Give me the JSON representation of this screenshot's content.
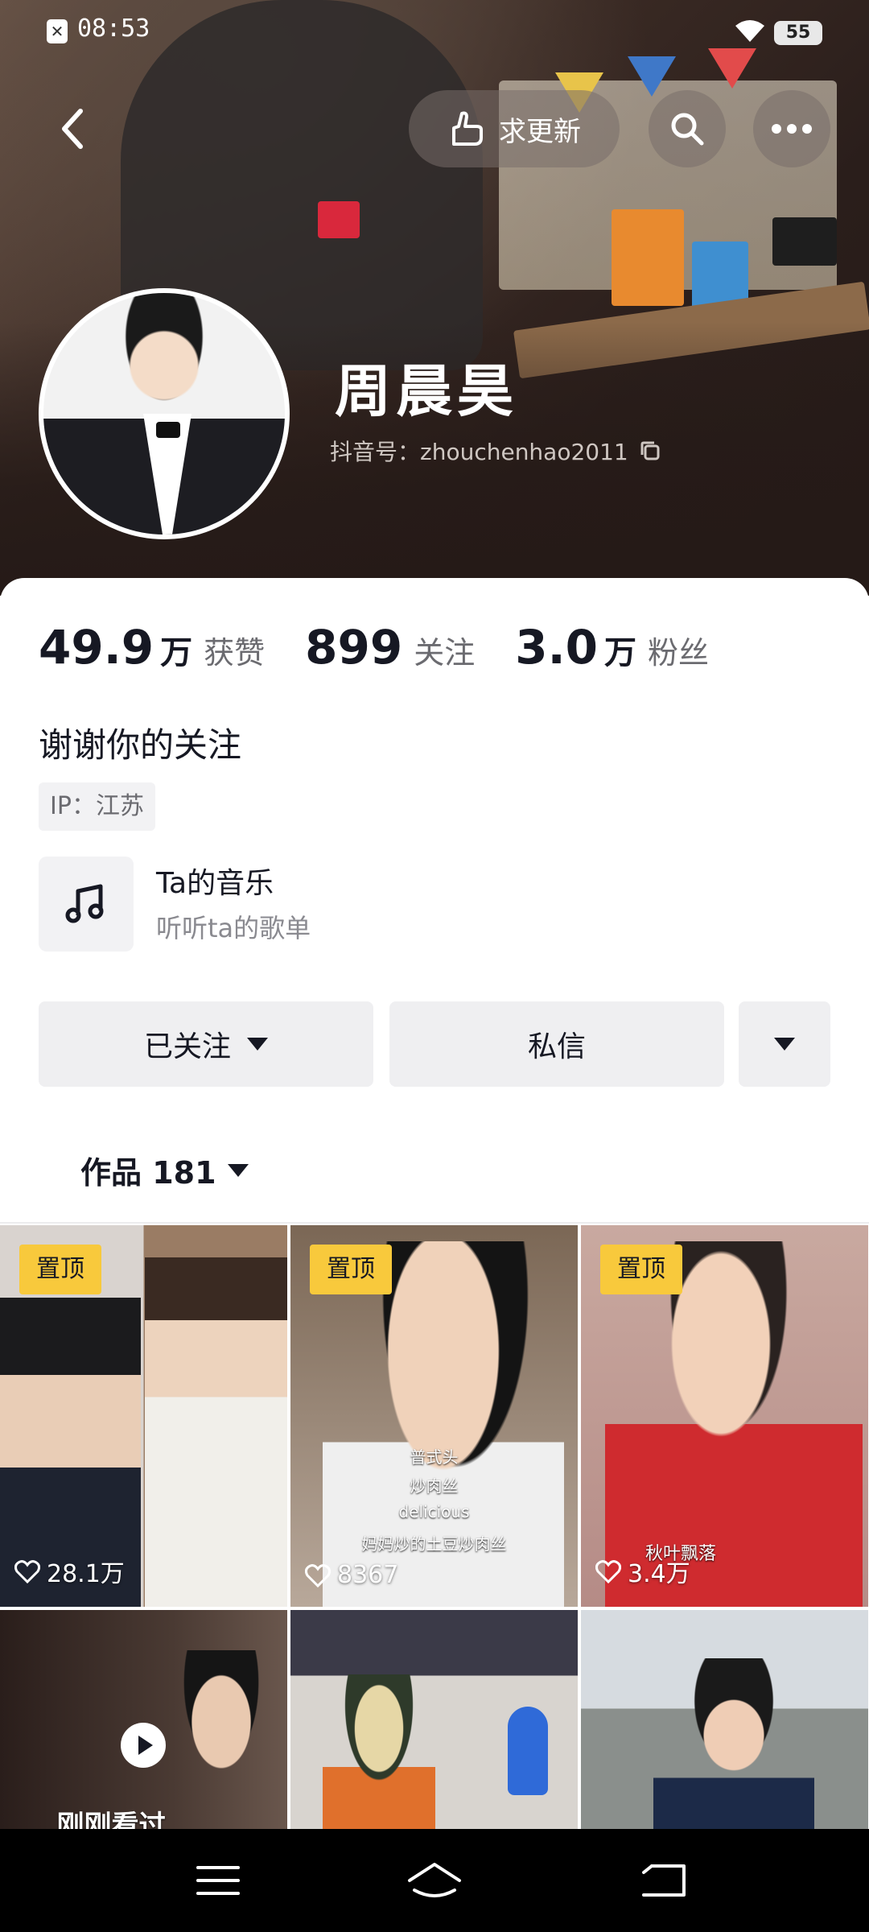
{
  "status": {
    "time": "08:53",
    "battery": "55"
  },
  "header": {
    "follow_new_label": "求更新",
    "username": "周晨昊",
    "douyin_id": "抖音号：zhouchenhao2011"
  },
  "stats": [
    {
      "num": "49.9",
      "unit": "万",
      "label": "获赞"
    },
    {
      "num": "899",
      "unit": "",
      "label": "关注"
    },
    {
      "num": "3.0",
      "unit": "万",
      "label": "粉丝"
    }
  ],
  "profile": {
    "bio": "谢谢你的关注",
    "ip": "IP：江苏",
    "music_title": "Ta的音乐",
    "music_sub": "听听ta的歌单"
  },
  "actions": {
    "followed": "已关注",
    "message": "私信"
  },
  "works": {
    "label": "作品 181"
  },
  "grid": [
    {
      "pin": "置顶",
      "likes": "28.1万",
      "caption": []
    },
    {
      "pin": "置顶",
      "likes": "8367",
      "caption": [
        "普式头",
        "炒肉丝",
        "delicious",
        "妈妈炒的土豆炒肉丝"
      ]
    },
    {
      "pin": "置顶",
      "likes": "3.4万",
      "caption": [
        "秋叶飘落"
      ]
    },
    {
      "pin": "",
      "likes": "",
      "caption": [
        "刚刚看过"
      ]
    },
    {
      "pin": "",
      "likes": "",
      "caption": []
    },
    {
      "pin": "",
      "likes": "",
      "caption": []
    }
  ],
  "colors": {
    "accent_pin": "#f8c93c",
    "banner_dark": "#251a17",
    "button_bg": "#efeff1"
  }
}
